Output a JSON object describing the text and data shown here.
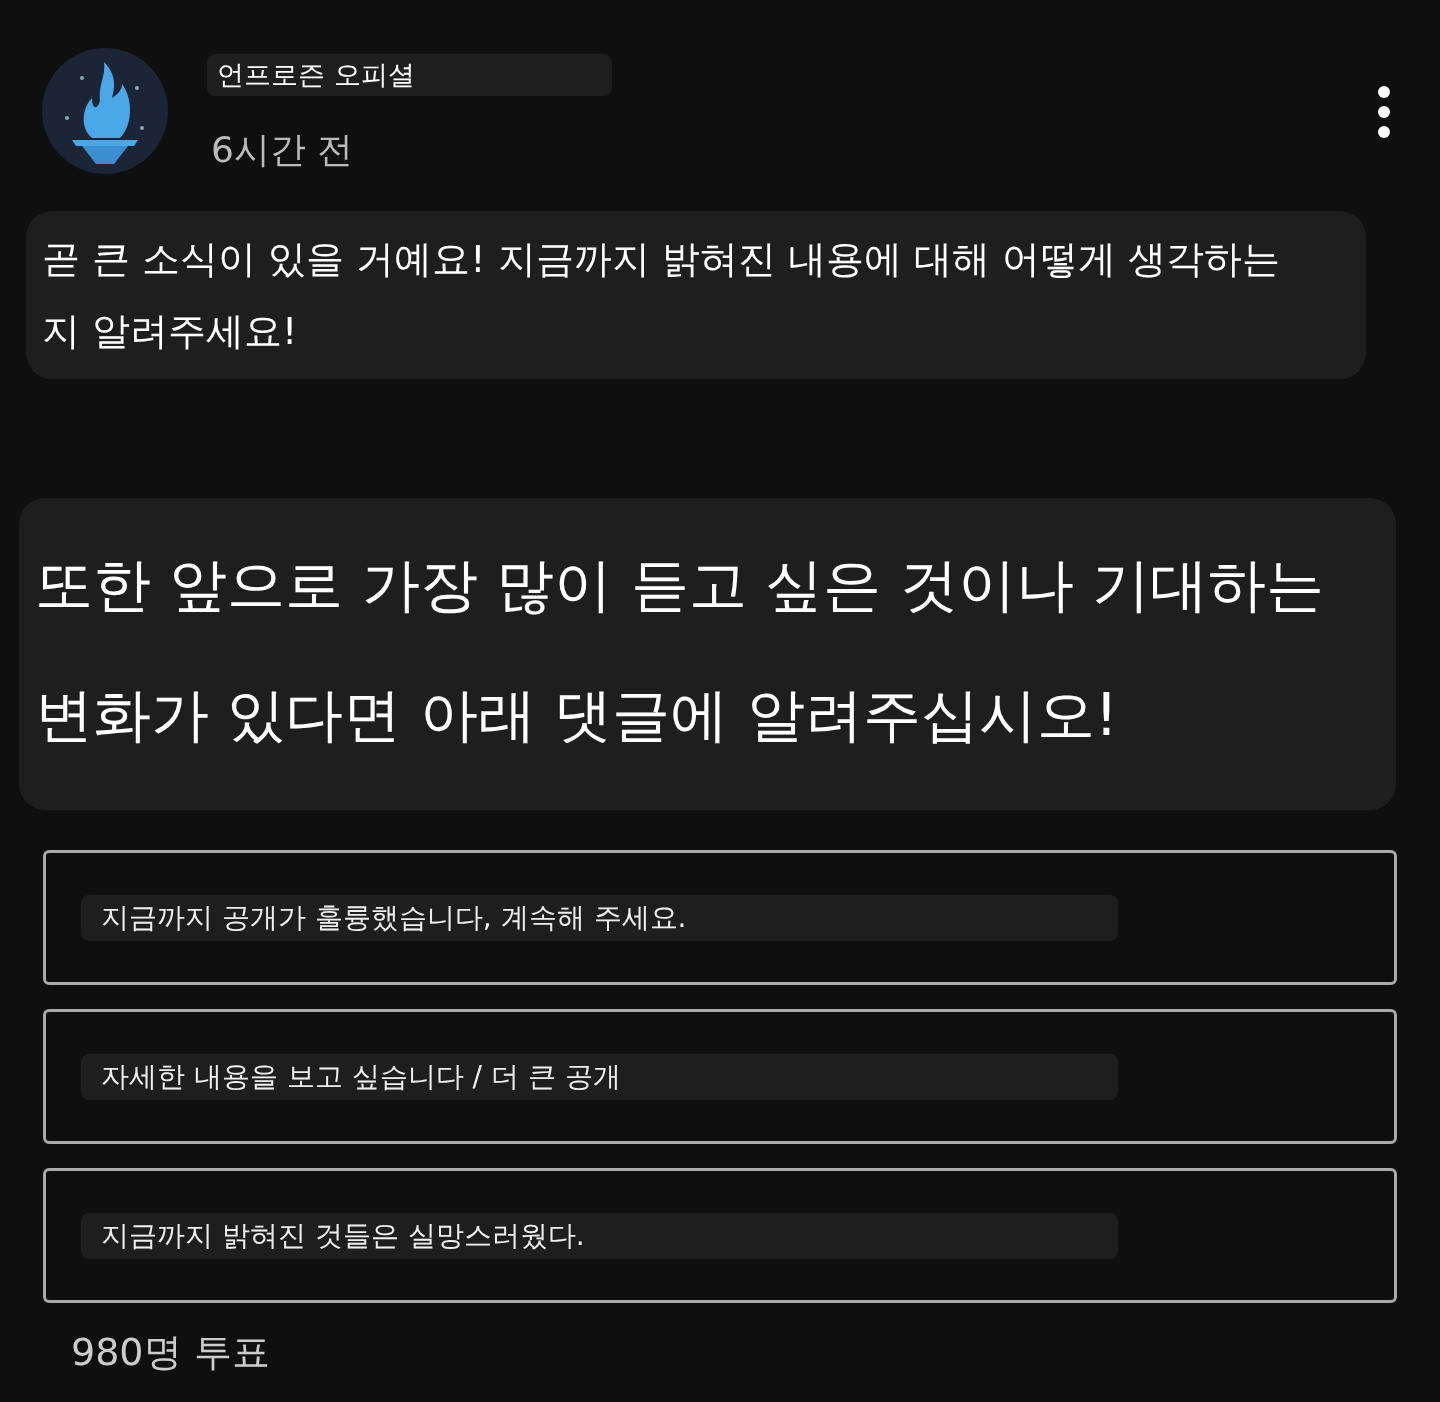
{
  "post": {
    "channel_name": "언프로즌 오피셜",
    "time": "6시간 전",
    "paragraphs": [
      "곧 큰 소식이 있을 거예요! 지금까지 밝혀진 내용에 대해 어떻게 생각하는지 알려주세요!",
      "또한 앞으로 가장 많이 듣고 싶은 것이나 기대하는 변화가 있다면 아래 댓글에 알려주십시오!"
    ]
  },
  "poll": {
    "options": [
      {
        "label": "지금까지 공개가 훌륭했습니다, 계속해 주세요."
      },
      {
        "label": "자세한 내용을 보고 싶습니다 / 더 큰 공개"
      },
      {
        "label": "지금까지 밝혀진 것들은 실망스러웠다."
      }
    ],
    "vote_count": "980명 투표"
  }
}
